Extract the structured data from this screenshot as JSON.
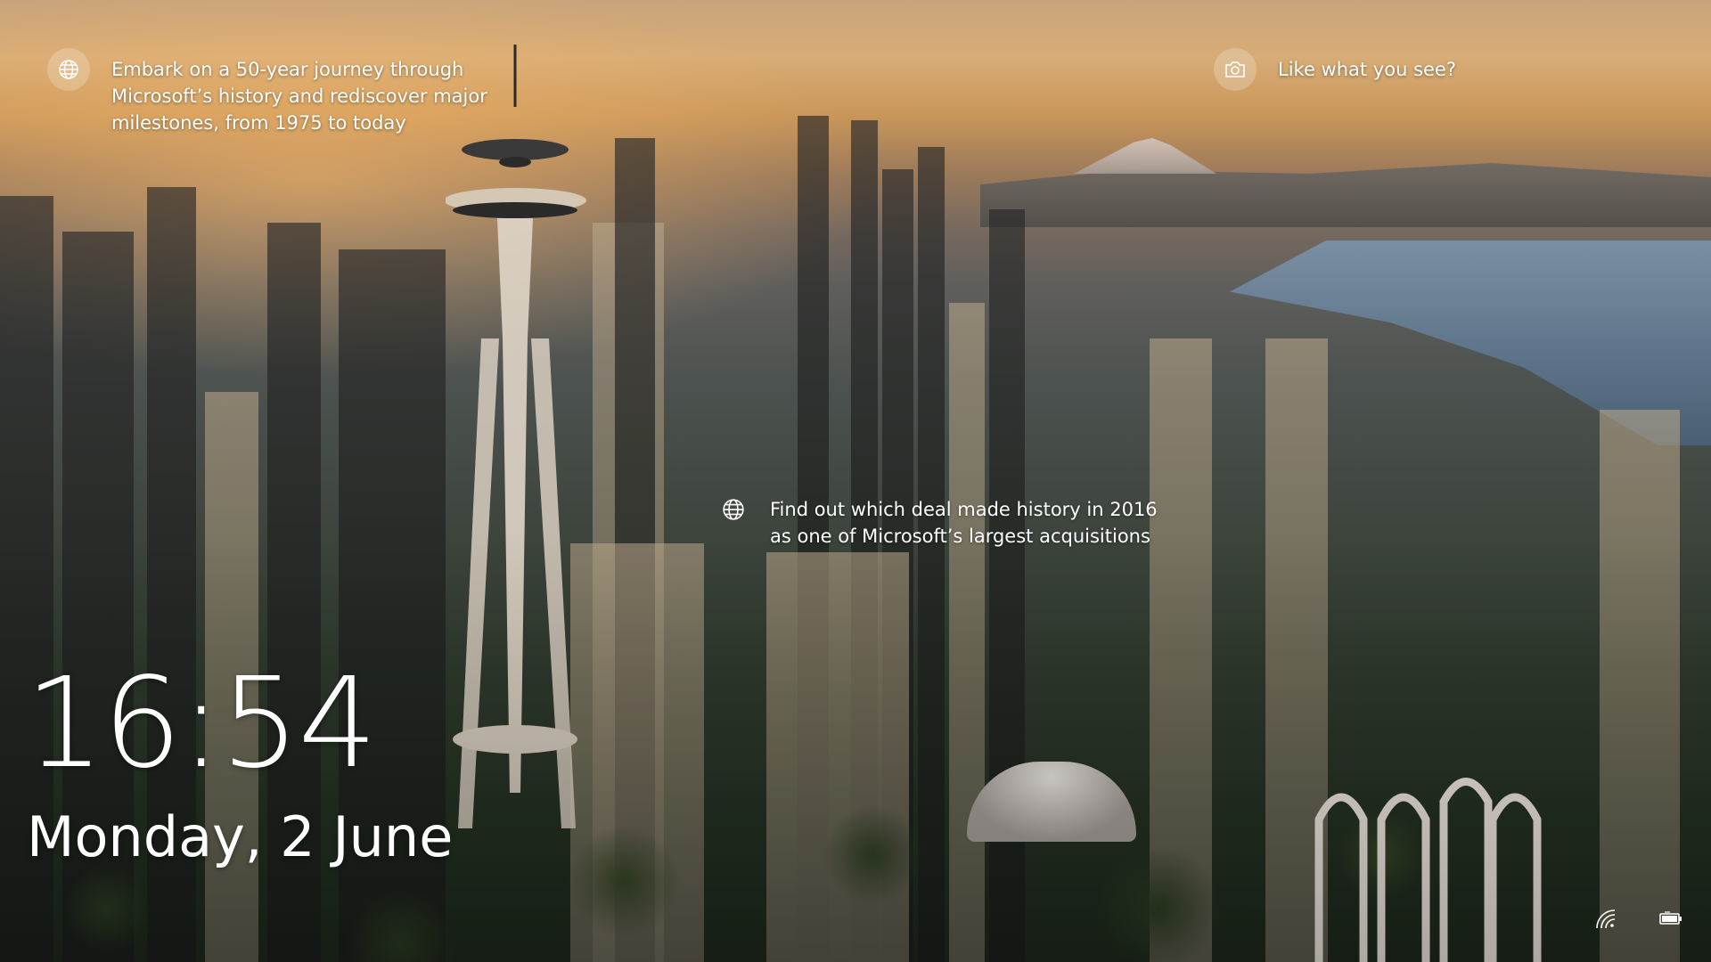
{
  "lock_screen": {
    "spotlight": {
      "top_left_fact": "Embark on a 50-year journey through\nMicrosoft’s history and rediscover major\nmilestones, from 1975 to today",
      "middle_fact": "Find out which deal made history in 2016\nas one of Microsoft’s largest acquisitions",
      "like_prompt": "Like what you see?"
    },
    "clock": {
      "time": "16:54",
      "date": "Monday, 2 June"
    },
    "icons": {
      "fact_icon": "globe-icon",
      "like_icon": "camera-icon",
      "network_icon": "wifi-icon",
      "battery_icon": "battery-icon"
    },
    "colors": {
      "text": "#ffffff",
      "icon_bubble": "rgba(255,255,255,0.22)"
    }
  }
}
